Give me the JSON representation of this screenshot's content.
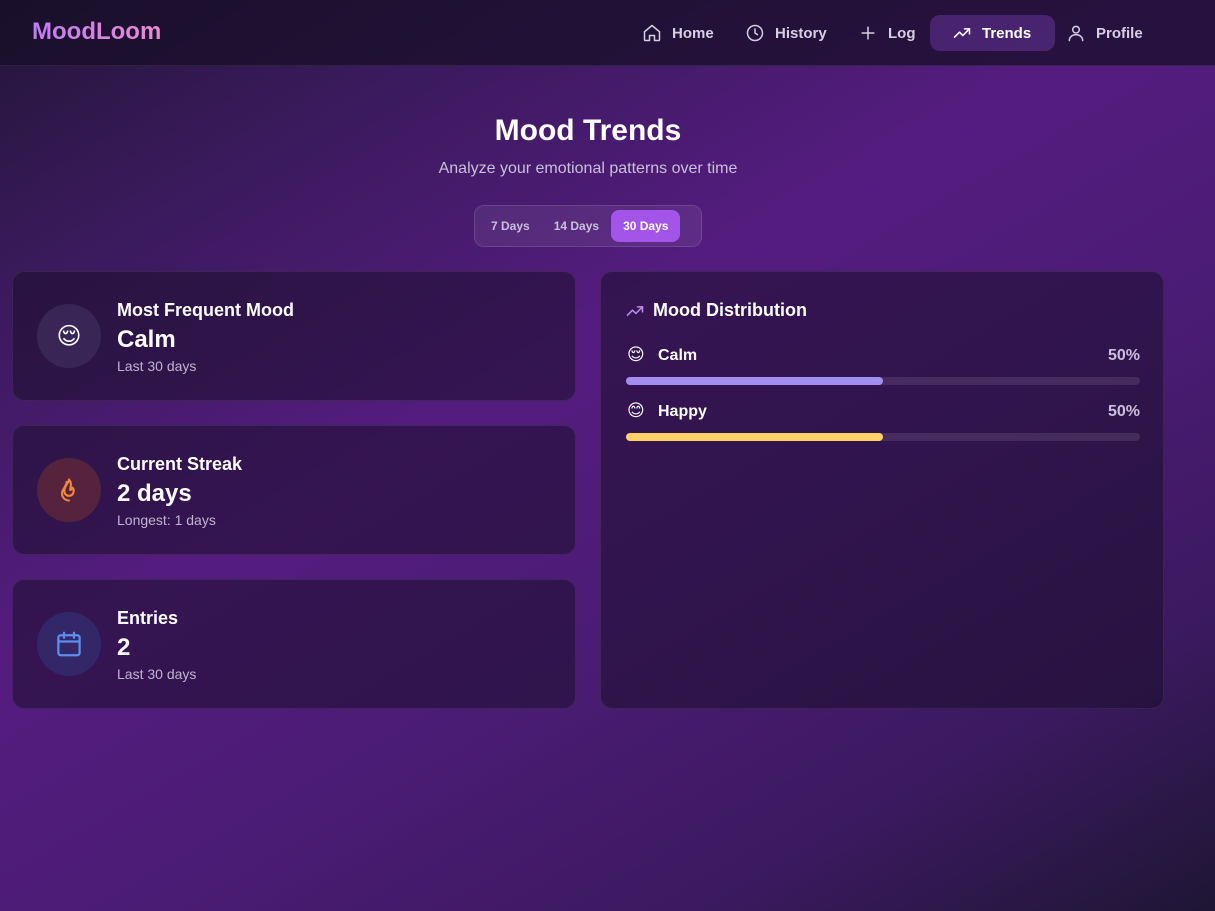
{
  "app": {
    "name": "MoodLoom"
  },
  "nav": {
    "items": [
      {
        "label": "Home",
        "icon": "home-icon"
      },
      {
        "label": "History",
        "icon": "clock-icon"
      },
      {
        "label": "Log",
        "icon": "plus-icon"
      },
      {
        "label": "Trends",
        "icon": "trending-up-icon",
        "active": true
      },
      {
        "label": "Profile",
        "icon": "user-icon"
      }
    ]
  },
  "header": {
    "title": "Mood Trends",
    "subtitle": "Analyze your emotional patterns over time"
  },
  "range": {
    "options": [
      "7 Days",
      "14 Days",
      "30 Days"
    ],
    "selected": "30 Days"
  },
  "stats": [
    {
      "label": "Most Frequent Mood",
      "value": "Calm",
      "sub": "Last 30 days",
      "icon": "relieved-face-icon",
      "emoji": "😌"
    },
    {
      "label": "Current Streak",
      "value": "2 days",
      "sub": "Longest: 1 days",
      "icon": "flame-icon"
    },
    {
      "label": "Entries",
      "value": "2",
      "sub": "Last 30 days",
      "icon": "calendar-icon"
    }
  ],
  "distribution": {
    "title": "Mood Distribution",
    "icon": "trending-up-icon",
    "items": [
      {
        "emoji": "😌",
        "name": "Calm",
        "percent_label": "50%",
        "fraction": 0.5,
        "color": "#a28ef0"
      },
      {
        "emoji": "😊",
        "name": "Happy",
        "percent_label": "50%",
        "fraction": 0.5,
        "color": "#fdd168"
      }
    ]
  },
  "colors": {
    "accent": "#a355ea",
    "flame": "#f0883e",
    "calendar": "#5b8ef0"
  }
}
